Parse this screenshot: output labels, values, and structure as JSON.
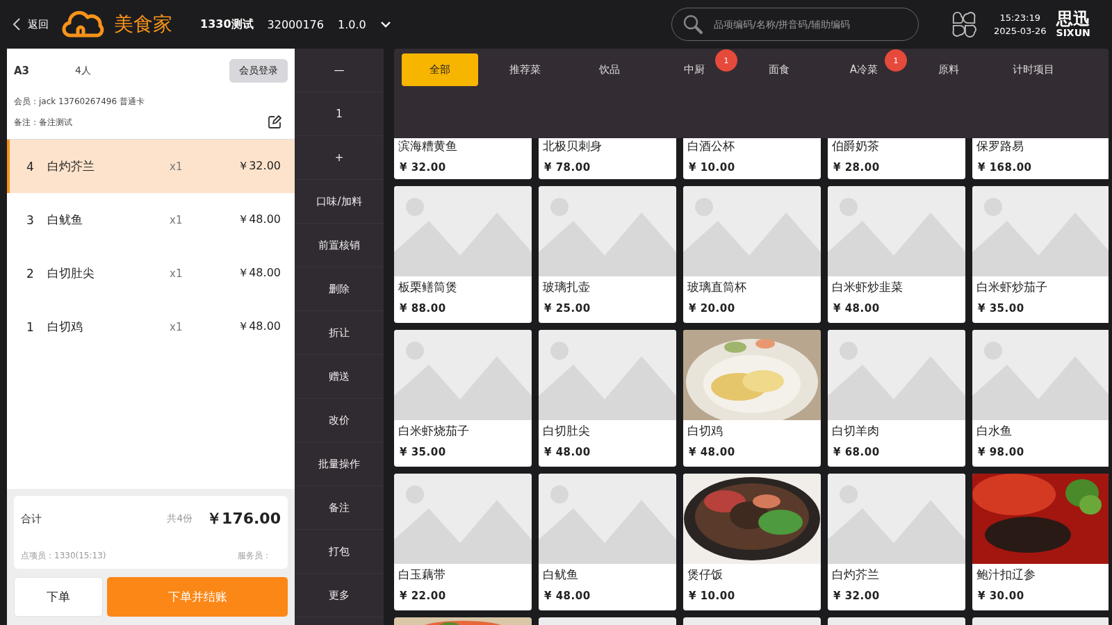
{
  "top_bar": {
    "back": "返回",
    "brand": "美食家",
    "store": "1330测试",
    "store_code": "32000176",
    "version": "1.0.0",
    "search": {
      "placeholder": "品项编码/名称/拼音码/辅助编码"
    },
    "time": "15:23:19",
    "date": "2025-03-26",
    "logo_main": "思迅",
    "logo_sub": "SIXUN"
  },
  "order": {
    "table": "A3",
    "guests": "4人",
    "member_login": "会员登录",
    "member": "会员：jack  13760267496  普通卡",
    "note": "备注：备注测试",
    "items": [
      {
        "no": "4",
        "name": "白灼芥兰",
        "qty": "x1",
        "price": "￥32.00",
        "selected": true
      },
      {
        "no": "3",
        "name": "白鱿鱼",
        "qty": "x1",
        "price": "￥48.00",
        "selected": false
      },
      {
        "no": "2",
        "name": "白切肚尖",
        "qty": "x1",
        "price": "￥48.00",
        "selected": false
      },
      {
        "no": "1",
        "name": "白切鸡",
        "qty": "x1",
        "price": "￥48.00",
        "selected": false
      }
    ],
    "total_label": "合计",
    "count": "共4份",
    "total": "￥176.00",
    "clerk": "点项员：1330(15:13)",
    "waiter": "服务员：",
    "buttons": [
      {
        "label": "下单",
        "primary": false
      },
      {
        "label": "下单并结账",
        "primary": true
      }
    ]
  },
  "actions": [
    "—",
    "1",
    "+",
    "口味/加料",
    "前置核销",
    "删除",
    "折让",
    "赠送",
    "改价",
    "批量操作",
    "备注",
    "打包",
    "更多"
  ],
  "categories": [
    {
      "label": "全部",
      "selected": true
    },
    {
      "label": "推荐菜",
      "selected": false
    },
    {
      "label": "饮品",
      "selected": false
    },
    {
      "label": "中厨",
      "selected": false,
      "badge": "1"
    },
    {
      "label": "面食",
      "selected": false
    },
    {
      "label": "A冷菜",
      "selected": false,
      "badge": "1"
    },
    {
      "label": "原料",
      "selected": false
    },
    {
      "label": "计时项目",
      "selected": false
    }
  ],
  "products": [
    {
      "kind": "text-only",
      "name": "滨海糟黄鱼",
      "price": "¥ 32.00"
    },
    {
      "kind": "text-only",
      "name": "北极贝刺身",
      "price": "¥ 78.00"
    },
    {
      "kind": "text-only",
      "name": "白酒公杯",
      "price": "¥ 10.00"
    },
    {
      "kind": "text-only",
      "name": "伯爵奶茶",
      "price": "¥ 28.00"
    },
    {
      "kind": "text-only",
      "name": "保罗路易",
      "price": "¥ 168.00"
    },
    {
      "kind": "placeholder",
      "name": "板栗鳝筒煲",
      "price": "¥ 88.00"
    },
    {
      "kind": "placeholder",
      "name": "玻璃扎壶",
      "price": "¥ 25.00"
    },
    {
      "kind": "placeholder",
      "name": "玻璃直筒杯",
      "price": "¥ 20.00"
    },
    {
      "kind": "placeholder",
      "name": "白米虾炒韭菜",
      "price": "¥ 48.00"
    },
    {
      "kind": "placeholder",
      "name": "白米虾炒茄子",
      "price": "¥ 35.00"
    },
    {
      "kind": "placeholder",
      "name": "白米虾烧茄子",
      "price": "¥ 35.00"
    },
    {
      "kind": "placeholder",
      "name": "白切肚尖",
      "price": "¥ 48.00"
    },
    {
      "kind": "chicken",
      "name": "白切鸡",
      "price": "¥ 48.00"
    },
    {
      "kind": "placeholder",
      "name": "白切羊肉",
      "price": "¥ 68.00"
    },
    {
      "kind": "placeholder",
      "name": "白水鱼",
      "price": "¥ 98.00"
    },
    {
      "kind": "placeholder",
      "name": "白玉藕带",
      "price": "¥ 22.00"
    },
    {
      "kind": "placeholder",
      "name": "白鱿鱼",
      "price": "¥ 48.00"
    },
    {
      "kind": "claypot",
      "name": "煲仔饭",
      "price": "¥ 10.00"
    },
    {
      "kind": "placeholder",
      "name": "白灼芥兰",
      "price": "¥ 32.00"
    },
    {
      "kind": "seafood",
      "name": "鲍汁扣辽参",
      "price": "¥ 30.00"
    },
    {
      "kind": "shrimp-image-only"
    },
    {
      "kind": "placeholder-image-only"
    },
    {
      "kind": "placeholder-image-only"
    },
    {
      "kind": "placeholder-image-only"
    },
    {
      "kind": "placeholder-image-only"
    }
  ]
}
